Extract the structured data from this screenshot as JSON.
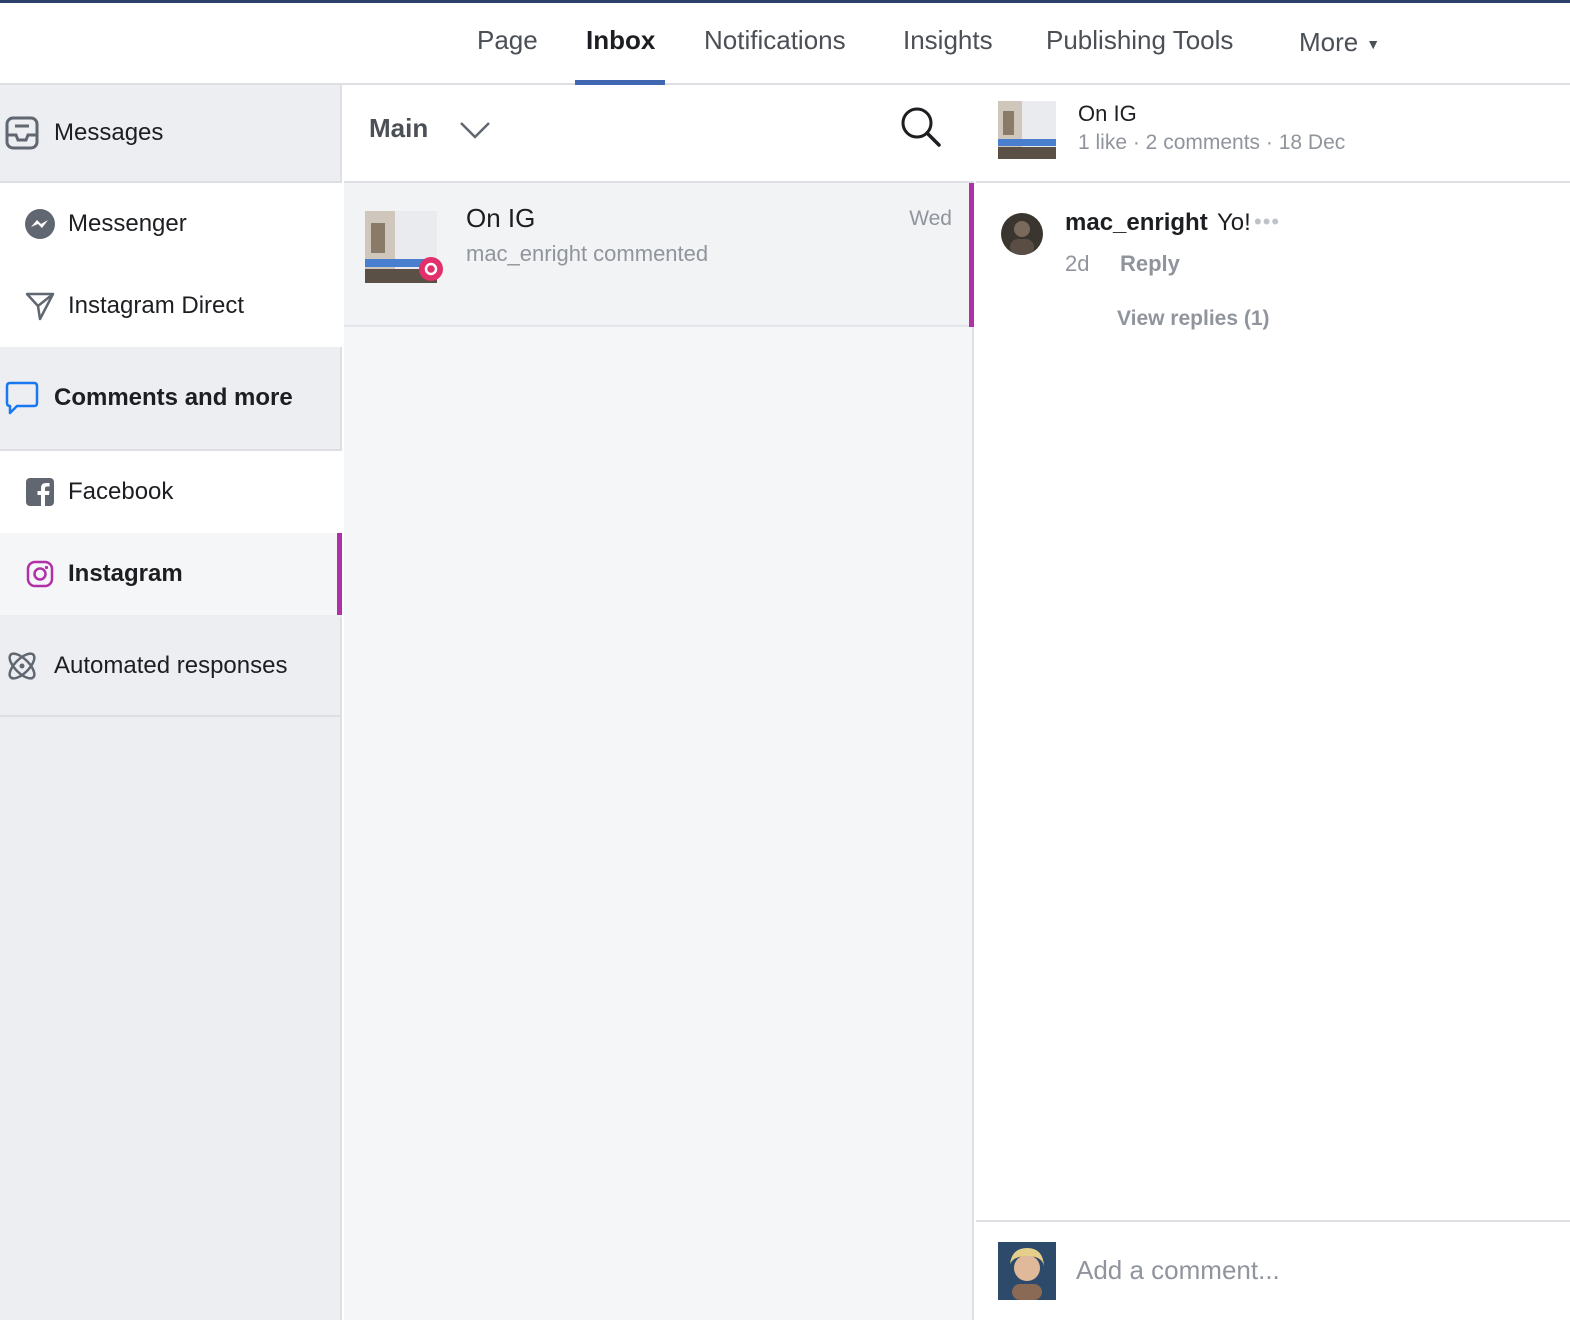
{
  "nav": {
    "tabs": [
      {
        "label": "Page"
      },
      {
        "label": "Inbox"
      },
      {
        "label": "Notifications"
      },
      {
        "label": "Insights"
      },
      {
        "label": "Publishing Tools"
      },
      {
        "label": "More"
      }
    ],
    "active_tab": "Inbox"
  },
  "sidebar": {
    "messages_header": "Messages",
    "messenger": "Messenger",
    "instagram_direct": "Instagram Direct",
    "comments_header": "Comments and more",
    "facebook": "Facebook",
    "instagram": "Instagram",
    "automated": "Automated responses"
  },
  "middle": {
    "filter_label": "Main",
    "conversation": {
      "title": "On IG",
      "subtitle": "mac_enright commented",
      "date": "Wed"
    }
  },
  "right": {
    "post_title": "On IG",
    "post_meta": "1 like · 2 comments · 18 Dec",
    "comment": {
      "user": "mac_enright",
      "text": "Yo!",
      "age": "2d",
      "reply_label": "Reply",
      "view_replies": "View replies (1)"
    },
    "composer_placeholder": "Add a comment..."
  },
  "colors": {
    "accent_blue": "#4267b2",
    "instagram_purple": "#b12fa7",
    "messenger_blue": "#1877f2"
  },
  "icons": {
    "messages": "inbox-tray-icon",
    "messenger": "messenger-icon",
    "instagram_direct": "paper-plane-icon",
    "comments": "speech-bubble-icon",
    "facebook": "facebook-icon",
    "instagram": "instagram-icon",
    "automated": "atom-icon",
    "search": "search-icon",
    "filter": "chevron-down-icon"
  }
}
